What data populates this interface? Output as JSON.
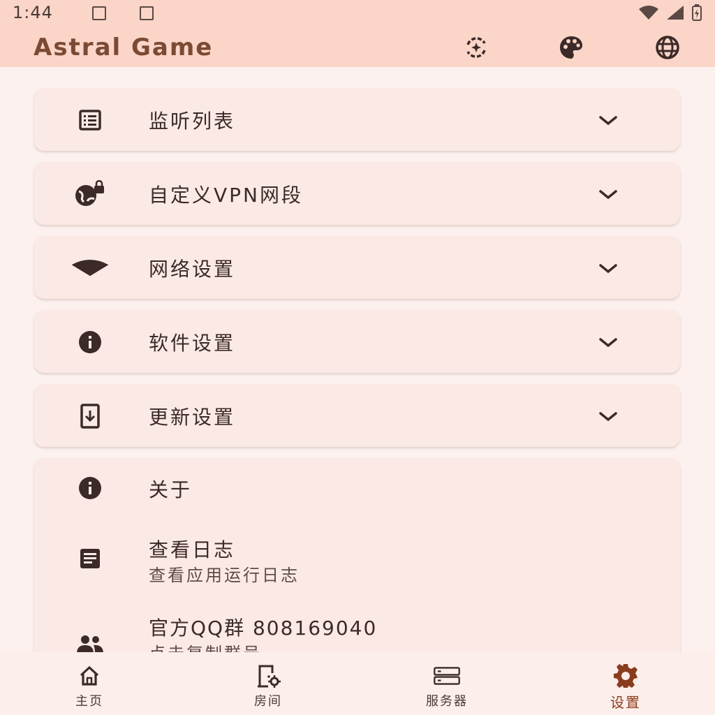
{
  "status": {
    "time": "1:44"
  },
  "app": {
    "title": "Astral Game"
  },
  "settings": {
    "items": [
      {
        "label": "监听列表",
        "icon": "list-icon"
      },
      {
        "label": "自定义VPN网段",
        "icon": "vpn-globe-lock-icon"
      },
      {
        "label": "网络设置",
        "icon": "wifi-icon"
      },
      {
        "label": "软件设置",
        "icon": "info-icon"
      },
      {
        "label": "更新设置",
        "icon": "download-box-icon"
      }
    ]
  },
  "about": {
    "title": "关于",
    "log_title": "查看日志",
    "log_subtitle": "查看应用运行日志",
    "qq_title": "官方QQ群 808169040",
    "qq_subtitle": "点击复制群号"
  },
  "nav": {
    "items": [
      {
        "label": "主页",
        "icon": "home-icon"
      },
      {
        "label": "房间",
        "icon": "room-icon"
      },
      {
        "label": "服务器",
        "icon": "server-icon"
      },
      {
        "label": "设置",
        "icon": "gear-icon",
        "active": true
      }
    ]
  },
  "colors": {
    "appbar": "#FAD5C8",
    "background": "#FCF1EE",
    "card": "#FBE9E5",
    "accent": "#8A3C1E",
    "title": "#7B4A34"
  }
}
